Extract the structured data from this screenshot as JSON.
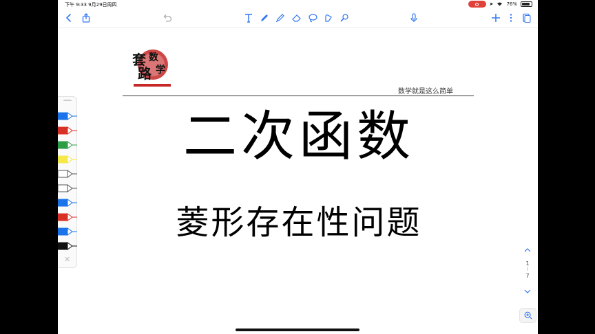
{
  "status_bar": {
    "time": "下午 9:33   9月29日周四",
    "battery": "76%",
    "battery_level": 0.76
  },
  "toolbar": {
    "back_icon": "chevron-left-icon",
    "share_icon": "share-icon",
    "undo_icon": "undo-icon",
    "text_tool_icon": "text-icon",
    "pen_tool_icon": "pen-icon",
    "highlighter_icon": "highlighter-icon",
    "eraser_icon": "eraser-icon",
    "lasso_icon": "lasso-icon",
    "shapes_icon": "shapes-icon",
    "element_icon": "sticker-icon",
    "mic_icon": "microphone-icon",
    "add_icon": "plus-icon",
    "more_icon": "more-vertical-icon",
    "pages_icon": "pages-icon",
    "accent_color": "#3478f6"
  },
  "pen_palette": {
    "pens": [
      {
        "color": "#1a73e8"
      },
      {
        "color": "#d93025"
      },
      {
        "color": "#2e9e46"
      },
      {
        "color": "#f5e94a"
      },
      {
        "color": "#ffffff"
      },
      {
        "color": "#ffffff"
      },
      {
        "color": "#1a73e8"
      },
      {
        "color": "#d93025"
      },
      {
        "color": "#1a73e8"
      },
      {
        "color": "#111111"
      }
    ]
  },
  "document": {
    "logo_text": "套路数学",
    "tagline": "数学就是这么简单",
    "title": "二次函数",
    "subtitle": "菱形存在性问题"
  },
  "page_nav": {
    "current": "1",
    "separator": "/",
    "total": "7"
  }
}
